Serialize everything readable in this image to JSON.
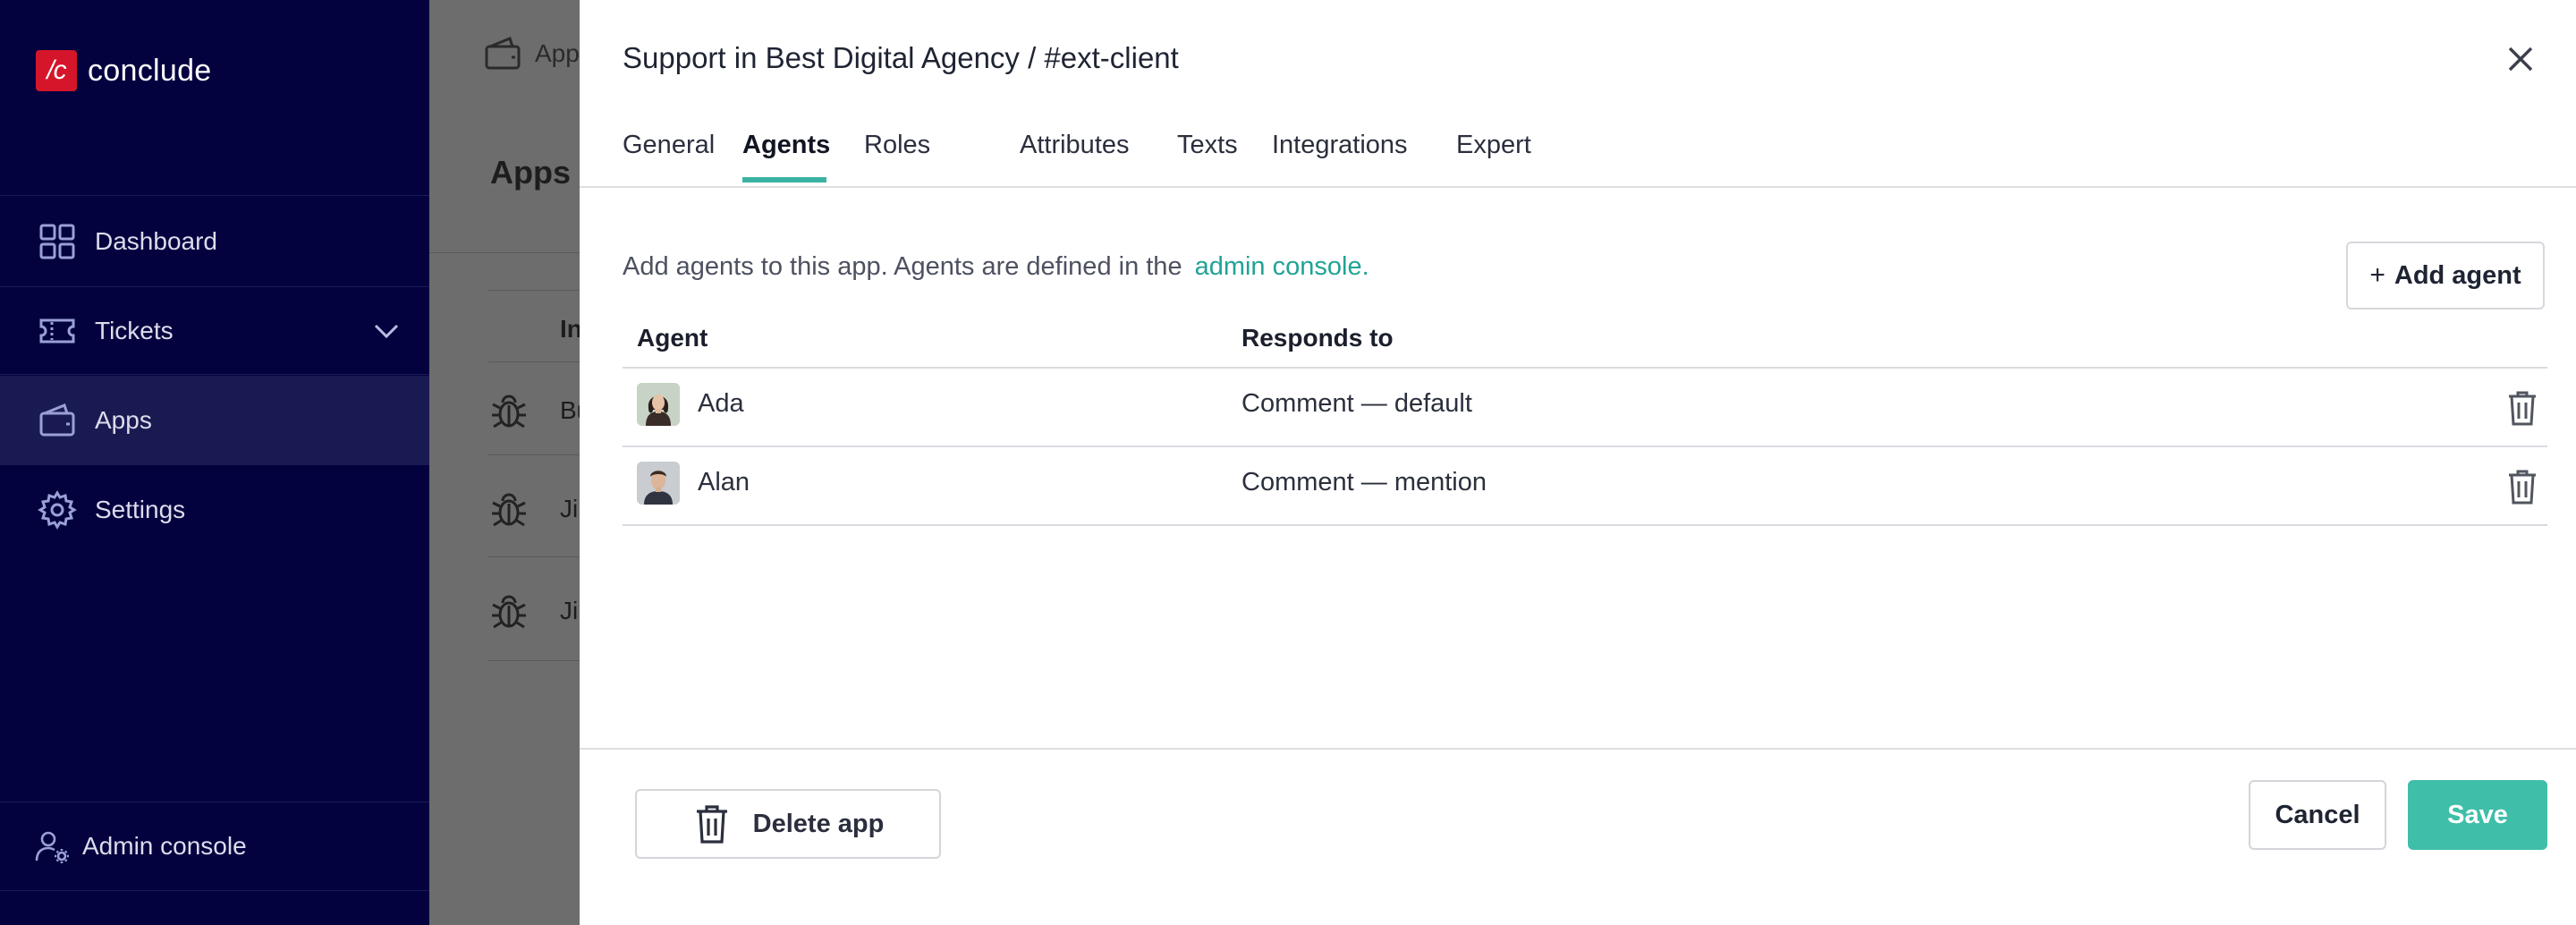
{
  "sidebar": {
    "brand": {
      "mark": "/c",
      "name": "conclude",
      "mark_color": "#d5152a"
    },
    "items": [
      {
        "label": "Dashboard",
        "icon": "dashboard-grid-icon"
      },
      {
        "label": "Tickets",
        "icon": "ticket-icon"
      },
      {
        "label": "Apps",
        "icon": "wallet-icon",
        "active": true
      },
      {
        "label": "Settings",
        "icon": "gear-icon"
      }
    ],
    "admin_label": "Admin console",
    "background_color": "#03023f"
  },
  "background_page": {
    "breadcrumb": "Apps",
    "title": "Apps t",
    "column_header": "In",
    "rows": [
      "Bu",
      "Ji",
      "Ji"
    ]
  },
  "modal": {
    "title": "Support in Best Digital Agency / #ext-client",
    "tabs": [
      "General",
      "Agents",
      "Roles",
      "Attributes",
      "Texts",
      "Integrations",
      "Expert"
    ],
    "active_tab": "Agents",
    "intro_text": "Add agents to this app. Agents are defined in the",
    "intro_link": "admin console.",
    "add_button": {
      "plus": "+",
      "label": "Add agent"
    },
    "table": {
      "headers": {
        "agent": "Agent",
        "responds_to": "Responds to"
      },
      "rows": [
        {
          "agent": "Ada",
          "responds_to": "Comment — default"
        },
        {
          "agent": "Alan",
          "responds_to": "Comment — mention"
        }
      ]
    },
    "footer": {
      "delete_label": "Delete app",
      "cancel_label": "Cancel",
      "save_label": "Save"
    },
    "accent_color": "#3bb3a4",
    "save_color": "#3fbea9"
  }
}
